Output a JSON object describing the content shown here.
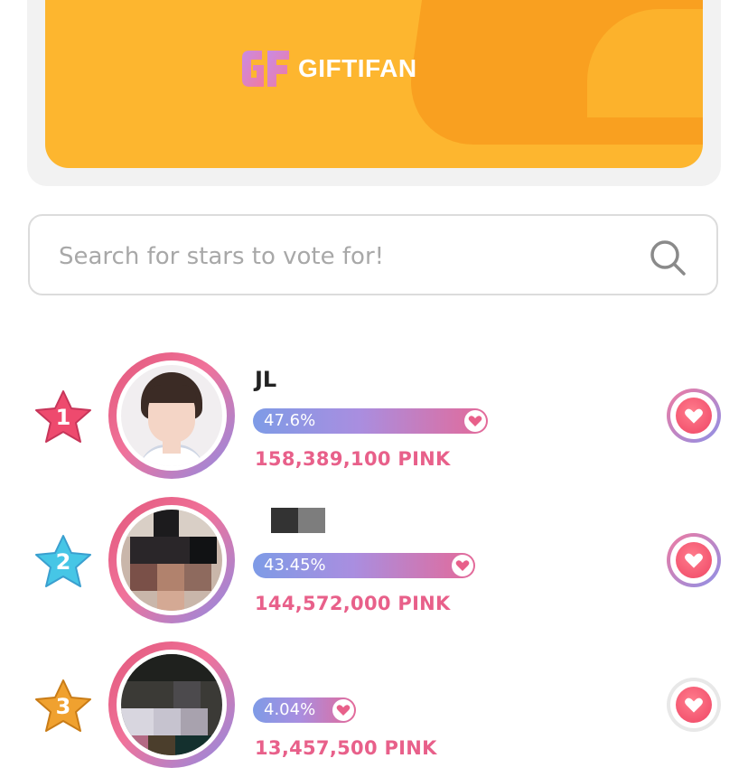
{
  "banner": {
    "brand_logo_text": "GF",
    "brand_name": "GIFTIFAN"
  },
  "search": {
    "placeholder": "Search for stars to vote for!",
    "value": ""
  },
  "ranking": [
    {
      "rank": "1",
      "name": "JL",
      "percent": "47.6%",
      "share": 47.6,
      "pink": "158,389,100 PINK",
      "star_color": "#ee4a6e"
    },
    {
      "rank": "2",
      "name": "",
      "percent": "43.45%",
      "share": 43.45,
      "pink": "144,572,000 PINK",
      "star_color": "#46c6e6"
    },
    {
      "rank": "3",
      "name": "",
      "percent": "4.04%",
      "share": 4.04,
      "pink": "13,457,500 PINK",
      "star_color": "#f0a12f"
    }
  ],
  "icons": {
    "search": "search-icon",
    "vote": "heart-icon",
    "rank": "star-icon"
  },
  "colors": {
    "banner_orange": "#fdb62f",
    "pink_text": "#e8608a",
    "bar_start": "#7e9be6",
    "bar_end": "#e46a99",
    "heart_red": "#ef4564"
  }
}
